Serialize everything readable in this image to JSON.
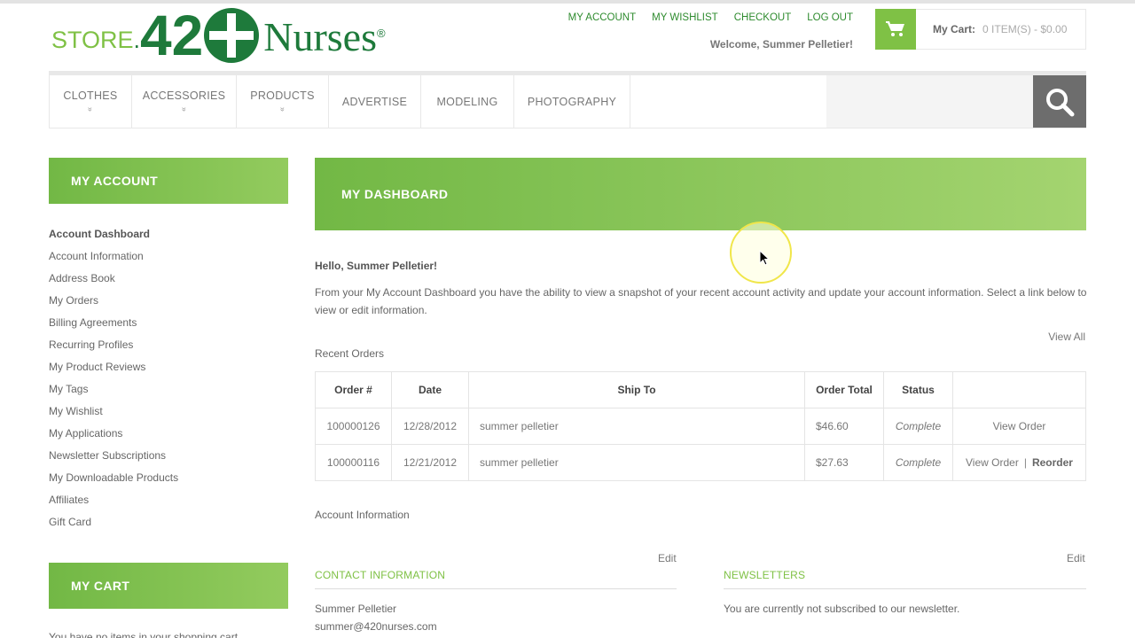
{
  "brand": {
    "store": "STORE",
    "dot": ".",
    "num_left": "42",
    "num_right": "",
    "name": "Nurses",
    "reg": "®"
  },
  "toplinks": [
    "MY ACCOUNT",
    "MY WISHLIST",
    "CHECKOUT",
    "LOG OUT"
  ],
  "welcome": "Welcome, Summer Pelletier!",
  "cart": {
    "label": "My Cart:",
    "items": "0 ITEM(S) - $0.00"
  },
  "nav": [
    {
      "label": "CLOTHES",
      "chevron": "»"
    },
    {
      "label": "ACCESSORIES",
      "chevron": "»"
    },
    {
      "label": "PRODUCTS",
      "chevron": "»"
    },
    {
      "label": "ADVERTISE"
    },
    {
      "label": "MODELING"
    },
    {
      "label": "PHOTOGRAPHY"
    }
  ],
  "sidebar": {
    "title": "MY ACCOUNT",
    "items": [
      "Account Dashboard",
      "Account Information",
      "Address Book",
      "My Orders",
      "Billing Agreements",
      "Recurring Profiles",
      "My Product Reviews",
      "My Tags",
      "My Wishlist",
      "My Applications",
      "Newsletter Subscriptions",
      "My Downloadable Products",
      "Affiliates",
      "Gift Card"
    ],
    "cart_title": "MY CART",
    "cart_text": "You have no items in your shopping cart."
  },
  "main": {
    "title": "MY DASHBOARD",
    "hello": "Hello, Summer Pelletier!",
    "intro": "From your My Account Dashboard you have the ability to view a snapshot of your recent account activity and update your account information. Select a link below to view or edit information.",
    "view_all": "View All",
    "recent_orders": "Recent Orders",
    "headers": [
      "Order #",
      "Date",
      "Ship To",
      "Order Total",
      "Status",
      ""
    ],
    "orders": [
      {
        "order": "100000126",
        "date": "12/28/2012",
        "ship_to": "summer pelletier",
        "total": "$46.60",
        "status": "Complete",
        "view": "View Order",
        "reorder": ""
      },
      {
        "order": "100000116",
        "date": "12/21/2012",
        "ship_to": "summer pelletier",
        "total": "$27.63",
        "status": "Complete",
        "view": "View Order",
        "reorder": "Reorder"
      }
    ],
    "account_info": "Account Information",
    "edit": "Edit",
    "contact_title": "CONTACT INFORMATION",
    "contact_name": "Summer Pelletier",
    "contact_email": "summer@420nurses.com",
    "news_title": "NEWSLETTERS",
    "news_text": "You are currently not subscribed to our newsletter."
  },
  "colors": {
    "accent": "#7fc145",
    "brand_dark": "#1e7a3b",
    "search_btn": "#6d6d6d"
  },
  "icons": {
    "cart": "cart-icon",
    "search": "search-icon",
    "cursor": "mouse-pointer-icon"
  }
}
